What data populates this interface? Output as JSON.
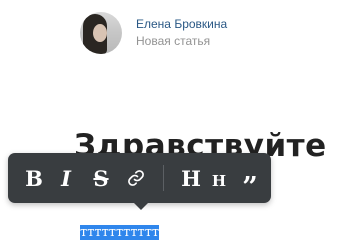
{
  "author": {
    "name": "Елена Бровкина",
    "subtitle": "Новая статья"
  },
  "article": {
    "heading": "Здравствуйте",
    "selected_text": "ттттттттттт"
  },
  "toolbar": {
    "bold": "B",
    "italic": "I",
    "strikethrough": "S",
    "link_icon": "link-icon",
    "heading_large": "H",
    "heading_small": "H",
    "quote": "”"
  },
  "colors": {
    "toolbar_bg": "#393d40",
    "selection": "#2f86ec",
    "author_link": "#2a5885",
    "muted": "#939393"
  }
}
